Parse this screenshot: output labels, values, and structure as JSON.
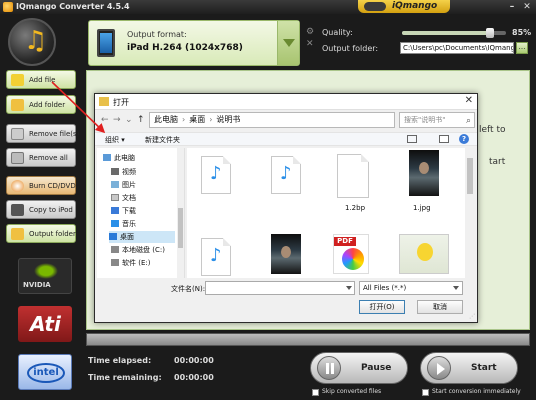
{
  "window": {
    "title": "IQmango Converter 4.5.4",
    "brand": "iQmango",
    "min_glyph": "–",
    "close_glyph": "✕"
  },
  "header": {
    "output_format_label": "Output format:",
    "output_format_value": "iPad H.264 (1024x768)",
    "quality_label": "Quality:",
    "quality_value": "85%",
    "quality_level": 0.85,
    "output_folder_label": "Output folder:",
    "output_folder_value": "C:\\Users\\pc\\Documents\\IQmango",
    "browse_glyph": "…",
    "icon_glyphs": [
      "⚙",
      "✕"
    ]
  },
  "sidebar": {
    "add_file": "Add file",
    "add_folder": "Add folder",
    "remove_files": "Remove file(s)",
    "remove_all": "Remove all",
    "burn_cd_dvd": "Burn CD/DVD",
    "copy_to_ipod": "Copy to iPod",
    "output_folder": "Output folder",
    "logos": {
      "nvidia": "NVIDIA",
      "ati": "Ati",
      "intel": "intel"
    }
  },
  "main": {
    "hint_left_to": "left to",
    "hint_start": "tart"
  },
  "status": {
    "time_elapsed_label": "Time elapsed:",
    "time_elapsed_value": "00:00:00",
    "time_remaining_label": "Time remaining:",
    "time_remaining_value": "00:00:00",
    "pause_label": "Pause",
    "start_label": "Start",
    "skip_converted_label": "Skip converted files",
    "start_immediately_label": "Start conversion immediately"
  },
  "dialog": {
    "title": "打开",
    "close_glyph": "✕",
    "nav": {
      "back": "←",
      "forward": "→",
      "down": "⌄",
      "up": "↑"
    },
    "breadcrumb": [
      "此电脑",
      "桌面",
      "说明书"
    ],
    "breadcrumb_sep": "›",
    "refresh_glyph": "↻",
    "search_placeholder": "搜索\"说明书\"",
    "search_icon": "⌕",
    "organize": "组织 ▾",
    "new_folder": "新建文件夹",
    "help": "?",
    "nav_tree": [
      "此电脑",
      "视频",
      "图片",
      "文档",
      "下载",
      "音乐",
      "桌面",
      "本地磁盘 (C:)",
      "软件 (E:)"
    ],
    "files": [
      {
        "name": "",
        "kind": "music-doc"
      },
      {
        "name": "",
        "kind": "music-doc"
      },
      {
        "name": "1.2bp",
        "kind": "blank-doc"
      },
      {
        "name": "1.jpg",
        "kind": "photo"
      },
      {
        "name": "",
        "kind": "music-doc"
      },
      {
        "name": "",
        "kind": "photo"
      },
      {
        "name": "",
        "kind": "pdf"
      },
      {
        "name": "",
        "kind": "cartoon"
      }
    ],
    "pdf_tag": "PDF",
    "music_glyph": "♪",
    "file_name_label": "文件名(N):",
    "file_name_value": "",
    "file_type_value": "All Files (*.*)",
    "open_button": "打开(O)",
    "cancel_button": "取消",
    "grip_glyph": "⋰"
  },
  "colors": {
    "accent_green": "#cfe3a4",
    "title_bar": "#1e1e1e",
    "brand_yellow": "#f4d24a",
    "dialog_selected": "#cde6f7",
    "annotation_red": "#e02020"
  }
}
